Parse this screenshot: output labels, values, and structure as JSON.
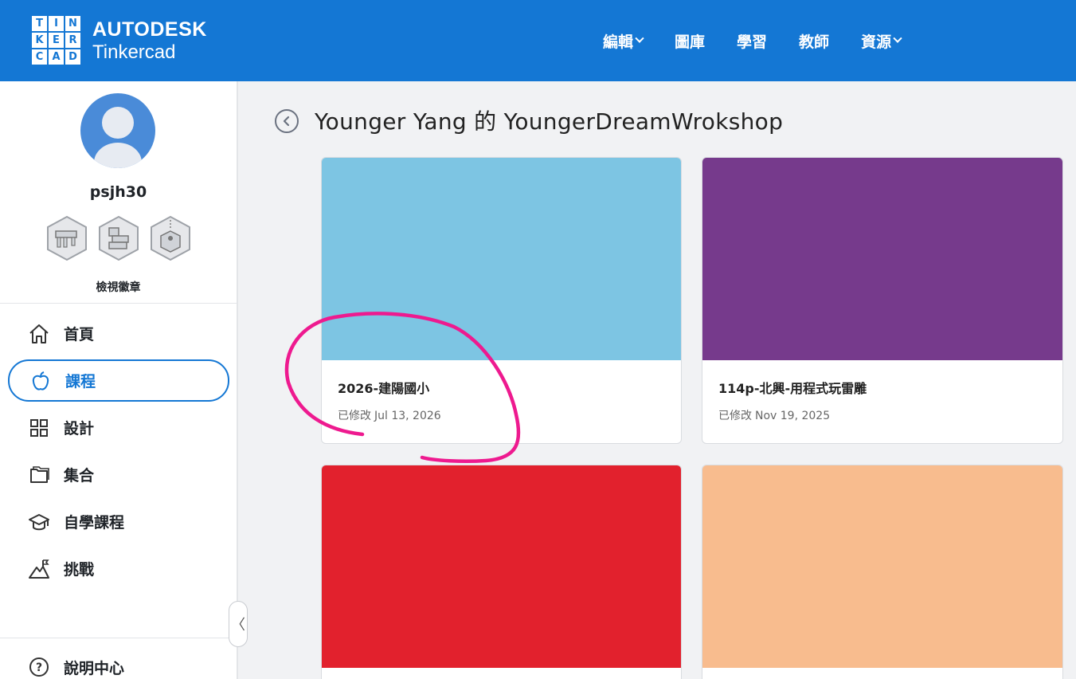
{
  "header": {
    "logo_letters": [
      "T",
      "I",
      "N",
      "K",
      "E",
      "R",
      "C",
      "A",
      "D"
    ],
    "brand_line1": "AUTODESK",
    "brand_line2": "Tinkercad",
    "nav": [
      {
        "label": "編輯",
        "has_dropdown": true
      },
      {
        "label": "圖庫",
        "has_dropdown": false
      },
      {
        "label": "學習",
        "has_dropdown": false
      },
      {
        "label": "教師",
        "has_dropdown": false
      },
      {
        "label": "資源",
        "has_dropdown": true
      }
    ],
    "accent_color": "#1477d4"
  },
  "profile": {
    "username": "psjh30",
    "view_badges_label": "檢視徽章"
  },
  "sidebar": {
    "items": [
      {
        "label": "首頁",
        "icon": "home-icon",
        "active": false
      },
      {
        "label": "課程",
        "icon": "apple-icon",
        "active": true
      },
      {
        "label": "設計",
        "icon": "grid-icon",
        "active": false
      },
      {
        "label": "集合",
        "icon": "folder-icon",
        "active": false
      },
      {
        "label": "自學課程",
        "icon": "graduation-cap-icon",
        "active": false
      },
      {
        "label": "挑戰",
        "icon": "mountain-flag-icon",
        "active": false
      }
    ],
    "help_label": "說明中心"
  },
  "main": {
    "title": "Younger Yang 的 YoungerDreamWrokshop",
    "cards": [
      {
        "title": "2026-建陽國小",
        "modified_label": "已修改",
        "modified_date": "Jul 13, 2026",
        "color": "#7dc5e3"
      },
      {
        "title": "114p-北興-用程式玩雷雕",
        "modified_label": "已修改",
        "modified_date": "Nov 19, 2025",
        "color": "#763a8c"
      },
      {
        "title": "",
        "modified_label": "",
        "modified_date": "",
        "color": "#e2212d"
      },
      {
        "title": "",
        "modified_label": "",
        "modified_date": "",
        "color": "#f8bc8e"
      }
    ]
  },
  "annotation_color": "#ee1a8f"
}
